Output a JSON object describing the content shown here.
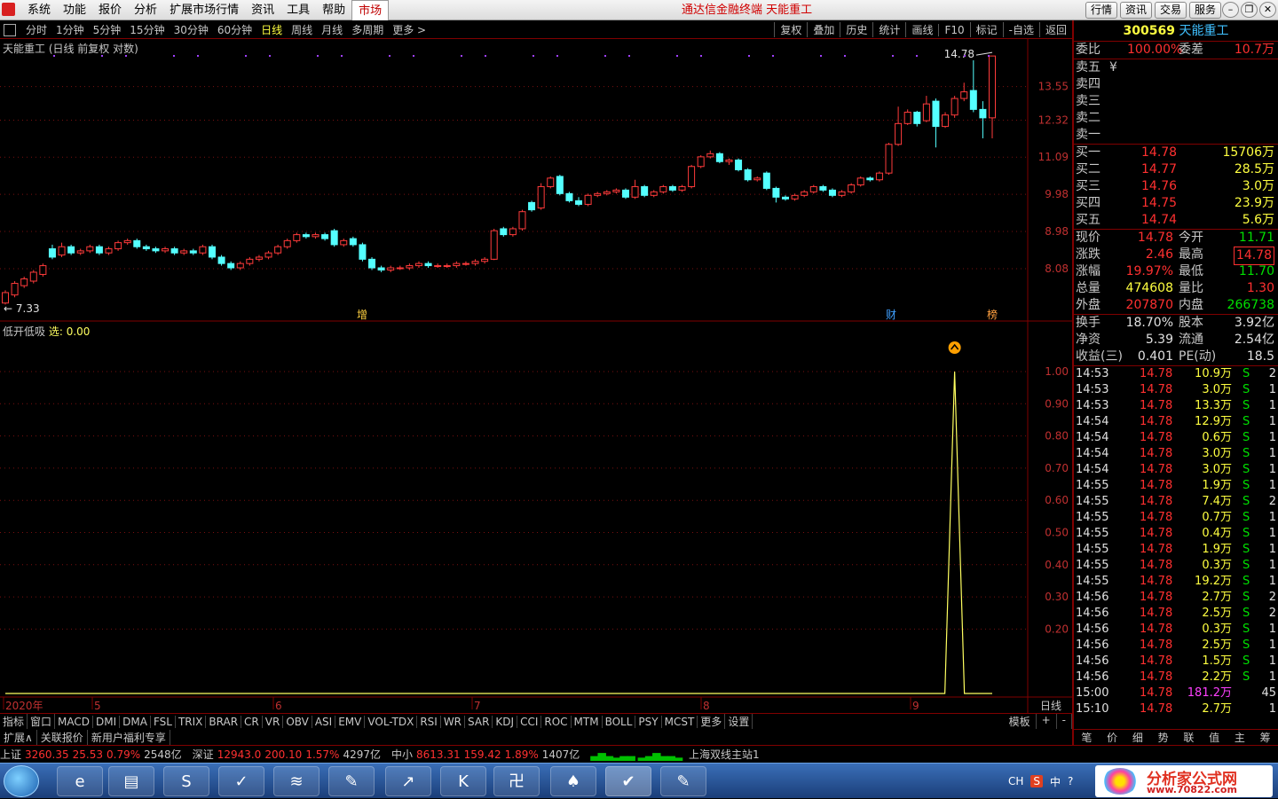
{
  "app_title": "通达信金融终端 天能重工",
  "menu": [
    "系统",
    "功能",
    "报价",
    "分析",
    "扩展市场行情",
    "资讯",
    "工具",
    "帮助",
    "市场"
  ],
  "top_buttons": [
    "行情",
    "资讯",
    "交易",
    "服务"
  ],
  "periods": [
    "分时",
    "1分钟",
    "5分钟",
    "15分钟",
    "30分钟",
    "60分钟",
    "日线",
    "周线",
    "月线",
    "多周期",
    "更多 >"
  ],
  "selected_period": "日线",
  "chart_tools": [
    "复权",
    "叠加",
    "历史",
    "统计",
    "画线",
    "F10",
    "标记",
    "-自选",
    "返回"
  ],
  "main_label": "天能重工 (日线 前复权 对数)",
  "sub_label": "低开低吸",
  "sub_label_sel": "选: 0.00",
  "tags": {
    "t1": "增",
    "t2": "财",
    "t3": "榜"
  },
  "x_labels": [
    "2020年",
    "5",
    "6",
    "7",
    "8",
    "9"
  ],
  "right_axis_label": "日线",
  "indicators": [
    "指标",
    "窗口",
    "MACD",
    "DMI",
    "DMA",
    "FSL",
    "TRIX",
    "BRAR",
    "CR",
    "VR",
    "OBV",
    "ASI",
    "EMV",
    "VOL-TDX",
    "RSI",
    "WR",
    "SAR",
    "KDJ",
    "CCI",
    "ROC",
    "MTM",
    "BOLL",
    "PSY",
    "MCST",
    "更多",
    "设置"
  ],
  "ind_right": [
    "模板",
    "+",
    "-"
  ],
  "ext_items": [
    "扩展∧",
    "关联报价",
    "新用户福利专享"
  ],
  "quote": {
    "code": "300569",
    "name": "天能重工",
    "webi_label": "委比",
    "webi": "100.00%",
    "weicha_label": "委差",
    "weicha": "10.7万",
    "sell": [
      {
        "l": "卖五",
        "p": "",
        "v": "",
        "extra": "¥"
      },
      {
        "l": "卖四",
        "p": "",
        "v": ""
      },
      {
        "l": "卖三",
        "p": "",
        "v": ""
      },
      {
        "l": "卖二",
        "p": "",
        "v": ""
      },
      {
        "l": "卖一",
        "p": "",
        "v": ""
      }
    ],
    "buy": [
      {
        "l": "买一",
        "p": "14.78",
        "v": "15706万"
      },
      {
        "l": "买二",
        "p": "14.77",
        "v": "28.5万"
      },
      {
        "l": "买三",
        "p": "14.76",
        "v": "3.0万"
      },
      {
        "l": "买四",
        "p": "14.75",
        "v": "23.9万"
      },
      {
        "l": "买五",
        "p": "14.74",
        "v": "5.6万"
      }
    ],
    "stats": [
      {
        "l1": "现价",
        "v1": "14.78",
        "l2": "今开",
        "v2": "11.71",
        "c1": "red",
        "c2": "grn"
      },
      {
        "l1": "涨跌",
        "v1": "2.46",
        "l2": "最高",
        "v2": "14.78",
        "c1": "red",
        "c2": "red"
      },
      {
        "l1": "涨幅",
        "v1": "19.97%",
        "l2": "最低",
        "v2": "11.70",
        "c1": "red",
        "c2": "grn"
      },
      {
        "l1": "总量",
        "v1": "474608",
        "l2": "量比",
        "v2": "1.30",
        "c1": "yel",
        "c2": "red"
      },
      {
        "l1": "外盘",
        "v1": "207870",
        "l2": "内盘",
        "v2": "266738",
        "c1": "red",
        "c2": "grn"
      }
    ],
    "stats2": [
      {
        "l1": "换手",
        "v1": "18.70%",
        "l2": "股本",
        "v2": "3.92亿"
      },
      {
        "l1": "净资",
        "v1": "5.39",
        "l2": "流通",
        "v2": "2.54亿"
      },
      {
        "l1": "收益(三)",
        "v1": "0.401",
        "l2": "PE(动)",
        "v2": "18.5"
      }
    ],
    "ticks": [
      [
        "14:53",
        "14.78",
        "10.9万",
        "S",
        "2"
      ],
      [
        "14:53",
        "14.78",
        "3.0万",
        "S",
        "1"
      ],
      [
        "14:53",
        "14.78",
        "13.3万",
        "S",
        "1"
      ],
      [
        "14:54",
        "14.78",
        "12.9万",
        "S",
        "1"
      ],
      [
        "14:54",
        "14.78",
        "0.6万",
        "S",
        "1"
      ],
      [
        "14:54",
        "14.78",
        "3.0万",
        "S",
        "1"
      ],
      [
        "14:54",
        "14.78",
        "3.0万",
        "S",
        "1"
      ],
      [
        "14:55",
        "14.78",
        "1.9万",
        "S",
        "1"
      ],
      [
        "14:55",
        "14.78",
        "7.4万",
        "S",
        "2"
      ],
      [
        "14:55",
        "14.78",
        "0.7万",
        "S",
        "1"
      ],
      [
        "14:55",
        "14.78",
        "0.4万",
        "S",
        "1"
      ],
      [
        "14:55",
        "14.78",
        "1.9万",
        "S",
        "1"
      ],
      [
        "14:55",
        "14.78",
        "0.3万",
        "S",
        "1"
      ],
      [
        "14:55",
        "14.78",
        "19.2万",
        "S",
        "1"
      ],
      [
        "14:56",
        "14.78",
        "2.7万",
        "S",
        "2"
      ],
      [
        "14:56",
        "14.78",
        "2.5万",
        "S",
        "2"
      ],
      [
        "14:56",
        "14.78",
        "0.3万",
        "S",
        "1"
      ],
      [
        "14:56",
        "14.78",
        "2.5万",
        "S",
        "1"
      ],
      [
        "14:56",
        "14.78",
        "1.5万",
        "S",
        "1"
      ],
      [
        "14:56",
        "14.78",
        "2.2万",
        "S",
        "1"
      ],
      [
        "15:00",
        "14.78",
        "181.2万",
        "",
        "45"
      ],
      [
        "15:10",
        "14.78",
        "2.7万",
        "",
        "1"
      ]
    ],
    "tabs": [
      "笔",
      "价",
      "细",
      "势",
      "联",
      "值",
      "主",
      "筹"
    ]
  },
  "status": {
    "sh_label": "上证",
    "sh": "3260.35",
    "sh_chg": "25.53",
    "sh_pct": "0.79%",
    "sh_amt": "2548亿",
    "sz_label": "深证",
    "sz": "12943.0",
    "sz_chg": "200.10",
    "sz_pct": "1.57%",
    "sz_amt": "4297亿",
    "zx_label": "中小",
    "zx": "8613.31",
    "zx_chg": "159.42",
    "zx_pct": "1.89%",
    "zx_amt": "1407亿",
    "server": "上海双线主站1"
  },
  "tray": {
    "lang": "CH",
    "ime": "中"
  },
  "watermark": {
    "line1": "分析家公式网",
    "line2": "www.70822.com"
  },
  "chart_data": {
    "type": "candlestick",
    "price_axis_ticks": [
      13.55,
      12.32,
      11.09,
      9.98,
      8.98,
      8.08
    ],
    "price_range": [
      7.0,
      15.2
    ],
    "high_label": "14.78",
    "low_label": "7.33",
    "candles": [
      [
        7.33,
        7.55,
        7.3,
        7.6
      ],
      [
        7.5,
        7.75,
        7.45,
        7.8
      ],
      [
        7.7,
        7.85,
        7.65,
        7.9
      ],
      [
        7.8,
        8.0,
        7.75,
        8.05
      ],
      [
        7.95,
        8.15,
        7.9,
        8.2
      ],
      [
        8.55,
        8.35,
        8.3,
        8.65
      ],
      [
        8.4,
        8.6,
        8.35,
        8.7
      ],
      [
        8.6,
        8.45,
        8.4,
        8.65
      ],
      [
        8.45,
        8.5,
        8.4,
        8.55
      ],
      [
        8.5,
        8.6,
        8.45,
        8.65
      ],
      [
        8.6,
        8.45,
        8.4,
        8.65
      ],
      [
        8.45,
        8.55,
        8.4,
        8.6
      ],
      [
        8.55,
        8.7,
        8.5,
        8.75
      ],
      [
        8.7,
        8.75,
        8.65,
        8.8
      ],
      [
        8.75,
        8.6,
        8.55,
        8.8
      ],
      [
        8.6,
        8.55,
        8.5,
        8.65
      ],
      [
        8.55,
        8.5,
        8.45,
        8.6
      ],
      [
        8.5,
        8.55,
        8.45,
        8.6
      ],
      [
        8.55,
        8.45,
        8.4,
        8.6
      ],
      [
        8.45,
        8.5,
        8.4,
        8.55
      ],
      [
        8.5,
        8.45,
        8.4,
        8.55
      ],
      [
        8.45,
        8.6,
        8.4,
        8.65
      ],
      [
        8.6,
        8.35,
        8.3,
        8.65
      ],
      [
        8.35,
        8.2,
        8.15,
        8.4
      ],
      [
        8.2,
        8.1,
        8.05,
        8.25
      ],
      [
        8.1,
        8.2,
        8.05,
        8.25
      ],
      [
        8.2,
        8.3,
        8.15,
        8.35
      ],
      [
        8.3,
        8.35,
        8.25,
        8.4
      ],
      [
        8.35,
        8.45,
        8.3,
        8.5
      ],
      [
        8.45,
        8.6,
        8.4,
        8.65
      ],
      [
        8.6,
        8.75,
        8.55,
        8.8
      ],
      [
        8.75,
        8.9,
        8.7,
        8.95
      ],
      [
        8.9,
        8.85,
        8.8,
        8.95
      ],
      [
        8.85,
        8.9,
        8.8,
        8.95
      ],
      [
        8.9,
        8.8,
        8.75,
        8.95
      ],
      [
        9.0,
        8.65,
        8.6,
        9.05
      ],
      [
        8.65,
        8.75,
        8.6,
        8.8
      ],
      [
        8.8,
        8.65,
        8.6,
        8.85
      ],
      [
        8.65,
        8.3,
        8.25,
        8.7
      ],
      [
        8.3,
        8.1,
        8.05,
        8.35
      ],
      [
        8.1,
        8.05,
        8.0,
        8.15
      ],
      [
        8.05,
        8.1,
        8.0,
        8.15
      ],
      [
        8.1,
        8.1,
        8.05,
        8.15
      ],
      [
        8.1,
        8.15,
        8.05,
        8.2
      ],
      [
        8.15,
        8.2,
        8.1,
        8.25
      ],
      [
        8.2,
        8.15,
        8.1,
        8.25
      ],
      [
        8.15,
        8.15,
        8.1,
        8.2
      ],
      [
        8.15,
        8.15,
        8.1,
        8.2
      ],
      [
        8.15,
        8.2,
        8.1,
        8.25
      ],
      [
        8.2,
        8.2,
        8.15,
        8.25
      ],
      [
        8.2,
        8.25,
        8.15,
        8.3
      ],
      [
        8.25,
        8.3,
        8.2,
        8.35
      ],
      [
        8.3,
        9.0,
        8.28,
        9.05
      ],
      [
        9.05,
        8.9,
        8.85,
        9.1
      ],
      [
        8.9,
        9.05,
        8.85,
        9.1
      ],
      [
        9.05,
        9.5,
        9.0,
        9.55
      ],
      [
        9.75,
        9.55,
        9.5,
        9.8
      ],
      [
        9.6,
        10.2,
        9.55,
        10.3
      ],
      [
        10.2,
        10.45,
        10.15,
        10.5
      ],
      [
        10.5,
        10.0,
        9.95,
        10.55
      ],
      [
        10.0,
        9.8,
        9.75,
        10.05
      ],
      [
        9.8,
        9.7,
        9.65,
        9.9
      ],
      [
        9.7,
        9.95,
        9.65,
        10.0
      ],
      [
        9.95,
        10.0,
        9.9,
        10.05
      ],
      [
        10.0,
        10.05,
        9.95,
        10.1
      ],
      [
        10.05,
        10.1,
        10.0,
        10.15
      ],
      [
        10.1,
        9.9,
        9.85,
        10.15
      ],
      [
        9.9,
        10.2,
        9.85,
        10.4
      ],
      [
        10.2,
        9.95,
        9.9,
        10.25
      ],
      [
        9.95,
        10.05,
        9.9,
        10.1
      ],
      [
        10.05,
        10.2,
        10.0,
        10.25
      ],
      [
        10.2,
        10.1,
        10.05,
        10.25
      ],
      [
        10.1,
        10.2,
        10.05,
        10.25
      ],
      [
        10.2,
        10.8,
        10.15,
        10.85
      ],
      [
        10.8,
        11.1,
        10.75,
        11.15
      ],
      [
        11.1,
        11.2,
        11.05,
        11.3
      ],
      [
        11.2,
        10.95,
        10.9,
        11.25
      ],
      [
        10.95,
        11.0,
        10.85,
        11.05
      ],
      [
        11.0,
        10.7,
        10.65,
        11.05
      ],
      [
        10.7,
        10.4,
        10.35,
        10.75
      ],
      [
        10.4,
        10.45,
        10.35,
        10.5
      ],
      [
        10.6,
        10.15,
        10.1,
        10.65
      ],
      [
        10.15,
        9.9,
        9.75,
        10.2
      ],
      [
        9.9,
        9.85,
        9.8,
        9.95
      ],
      [
        9.85,
        9.95,
        9.8,
        10.0
      ],
      [
        9.95,
        10.05,
        9.9,
        10.1
      ],
      [
        10.05,
        10.2,
        10.0,
        10.25
      ],
      [
        10.2,
        10.1,
        10.05,
        10.25
      ],
      [
        10.1,
        9.95,
        9.9,
        10.15
      ],
      [
        9.95,
        10.05,
        9.9,
        10.1
      ],
      [
        10.05,
        10.25,
        10.0,
        10.3
      ],
      [
        10.25,
        10.45,
        10.2,
        10.5
      ],
      [
        10.45,
        10.4,
        10.35,
        10.5
      ],
      [
        10.4,
        10.6,
        10.35,
        10.65
      ],
      [
        10.6,
        11.5,
        10.55,
        11.55
      ],
      [
        11.5,
        12.2,
        11.45,
        12.8
      ],
      [
        12.2,
        12.6,
        12.15,
        12.7
      ],
      [
        12.6,
        12.2,
        12.1,
        12.65
      ],
      [
        12.3,
        12.9,
        12.25,
        13.2
      ],
      [
        13.0,
        12.1,
        11.4,
        13.1
      ],
      [
        12.1,
        12.5,
        12.05,
        12.6
      ],
      [
        12.5,
        13.1,
        12.4,
        13.2
      ],
      [
        13.1,
        13.35,
        13.0,
        13.7
      ],
      [
        13.4,
        12.7,
        12.6,
        14.6
      ],
      [
        12.7,
        12.4,
        11.7,
        13.0
      ],
      [
        12.4,
        14.78,
        11.7,
        14.78
      ]
    ],
    "sub_indicator": {
      "name": "低开低吸",
      "ticks": [
        1.0,
        0.9,
        0.8,
        0.7,
        0.6,
        0.5,
        0.4,
        0.3,
        0.2
      ],
      "range": [
        0,
        1
      ],
      "signal_index": 101
    }
  }
}
